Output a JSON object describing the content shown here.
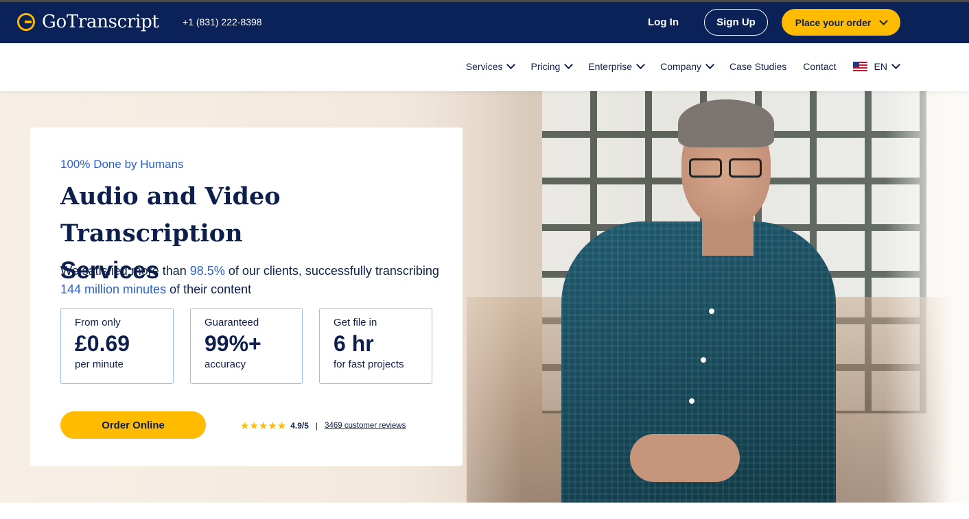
{
  "brand": {
    "name": "GoTranscript",
    "accent": "#ffbb00",
    "navy": "#0a2257",
    "link_blue": "#2c62c8"
  },
  "topbar": {
    "phone": "+1 (831) 222-8398",
    "login": "Log In",
    "signup": "Sign Up",
    "place_order": "Place your order"
  },
  "nav": {
    "items": [
      {
        "label": "Services",
        "dropdown": true
      },
      {
        "label": "Pricing",
        "dropdown": true
      },
      {
        "label": "Enterprise",
        "dropdown": true
      },
      {
        "label": "Company",
        "dropdown": true
      },
      {
        "label": "Case Studies",
        "dropdown": false
      },
      {
        "label": "Contact",
        "dropdown": false
      }
    ],
    "language": "EN",
    "language_icon": "us-flag-icon"
  },
  "hero": {
    "eyebrow": "100% Done by Humans",
    "title_line1": "Audio and Video Transcription",
    "title_line2": "Services",
    "lead_part1": "We satisfied more than ",
    "lead_hl1": "98.5%",
    "lead_part2": " of our clients, successfully transcribing ",
    "lead_hl2": "144 million minutes",
    "lead_part3": " of their content",
    "stats": [
      {
        "top": "From only",
        "big": "£0.69",
        "bottom": "per minute"
      },
      {
        "top": "Guaranteed",
        "big": "99%+",
        "bottom": "accuracy"
      },
      {
        "top": "Get file in",
        "big": "6 hr",
        "bottom": "for fast projects"
      }
    ],
    "order_button": "Order Online",
    "rating": {
      "stars": "★★★★★",
      "score": "4.9/5",
      "separator": "|",
      "reviews": "3469 customer reviews",
      "star_value": 4.9
    }
  }
}
